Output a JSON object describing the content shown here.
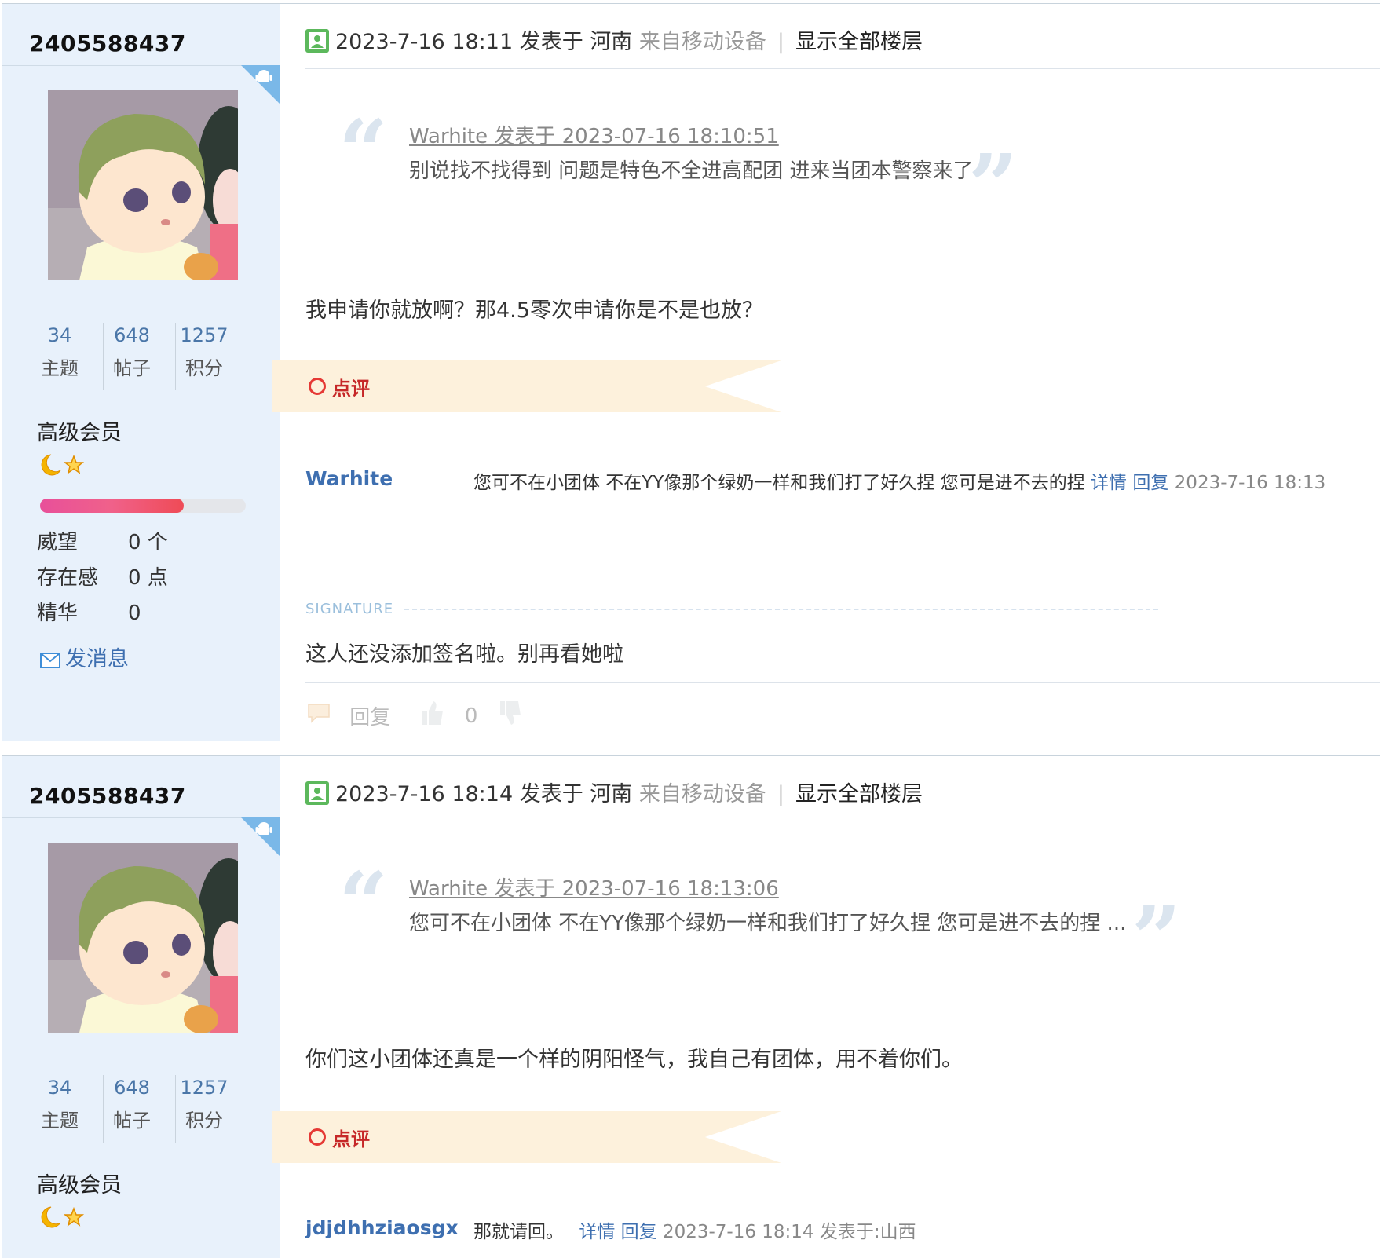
{
  "posts": [
    {
      "user": {
        "name": "2405588437",
        "stats": [
          {
            "num": "34",
            "label": "主题"
          },
          {
            "num": "648",
            "label": "帖子"
          },
          {
            "num": "1257",
            "label": "积分"
          }
        ],
        "level": "高级会员",
        "progress": 0.7,
        "attrs": [
          {
            "k": "威望",
            "v": "0 个"
          },
          {
            "k": "存在感",
            "v": "0 点"
          },
          {
            "k": "精华",
            "v": "0"
          }
        ],
        "send_message": "发消息"
      },
      "header": {
        "time": "2023-7-16 18:11 发表于 河南",
        "from": "来自移动设备",
        "sep": "|",
        "show_all": "显示全部楼层"
      },
      "quote": {
        "meta": "Warhite 发表于 2023-07-16 18:10:51",
        "text": "别说找不找得到 问题是特色不全进高配团  进来当团本警察来了"
      },
      "body": "我申请你就放啊？那4.5零次申请你是不是也放？",
      "review_label": "点评",
      "comment": {
        "author": "Warhite",
        "text": "您可不在小团体 不在YY像那个绿奶一样和我们打了好久捏 您可是进不去的捏",
        "detail": "详情",
        "reply": "回复",
        "meta": "2023-7-16 18:13"
      },
      "signature_label": "SIGNATURE",
      "signature": "这人还没添加签名啦。别再看她啦",
      "footer": {
        "reply": "回复",
        "likes": "0"
      }
    },
    {
      "user": {
        "name": "2405588437",
        "stats": [
          {
            "num": "34",
            "label": "主题"
          },
          {
            "num": "648",
            "label": "帖子"
          },
          {
            "num": "1257",
            "label": "积分"
          }
        ],
        "level": "高级会员"
      },
      "header": {
        "time": "2023-7-16 18:14 发表于 河南",
        "from": "来自移动设备",
        "sep": "|",
        "show_all": "显示全部楼层"
      },
      "quote": {
        "meta": "Warhite 发表于 2023-07-16 18:13:06",
        "text": "您可不在小团体 不在YY像那个绿奶一样和我们打了好久捏  您可是进不去的捏 ..."
      },
      "body": "你们这小团体还真是一个样的阴阳怪气，我自己有团体，用不着你们。",
      "review_label": "点评",
      "comment": {
        "author": "jdjdhhziaosgx",
        "text": "那就请回。",
        "detail": "详情",
        "reply": "回复",
        "meta": "2023-7-16 18:14 发表于:山西"
      }
    }
  ],
  "colors": {
    "sidebar_bg": "#e8f1fb",
    "link": "#3e6fb0",
    "review_bg": "#fdf1dc",
    "review_text": "#c62828",
    "progress": "#f0618a"
  }
}
